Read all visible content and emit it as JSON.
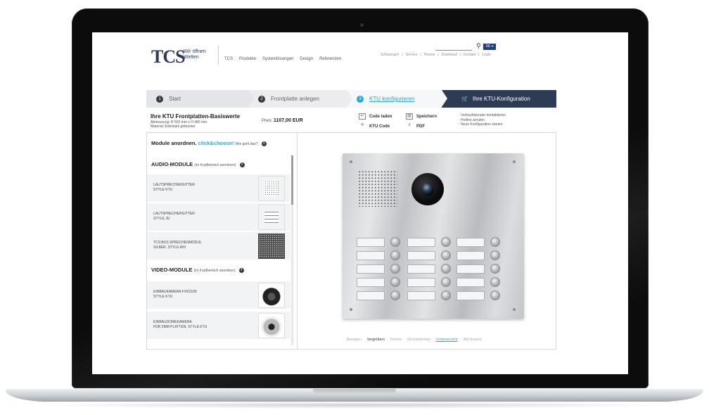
{
  "header": {
    "logo": "TCS",
    "tagline_lines": [
      "Wir öffnen",
      "Welten"
    ],
    "main_nav": [
      "TCS",
      "Produkte",
      "Systemlösungen",
      "Design",
      "Referenzen"
    ],
    "language": "DE ▾",
    "service_nav": [
      "Schulungen",
      "Service",
      "Presse",
      "Download",
      "Kontakt",
      "Login"
    ]
  },
  "steps": [
    {
      "num": "1",
      "label": "Start"
    },
    {
      "num": "2",
      "label": "Frontplatte anlegen"
    },
    {
      "num": "3",
      "label": "KTU konfigurieren"
    },
    {
      "num": "",
      "label": "Ihre KTU-Konfiguration"
    }
  ],
  "summary": {
    "title": "Ihre KTU Frontplatten-Basiswerte",
    "dimensions": "Abmessung: B 500 mm x H 480 mm",
    "material": "Material:  Edelstahl gebürstet",
    "price_label": "Preis:",
    "price_value": "1107,00 EUR",
    "tools": {
      "load": "Code laden",
      "save": "Speichern",
      "code": "KTU Code",
      "pdf": "PDF"
    },
    "links": [
      "· Verkaufsberater kontaktieren",
      "· Hotline anrufen",
      "· Neue Konfiguration starten"
    ]
  },
  "modules": {
    "arrange_title": "Module anordnen.",
    "arrange_highlight": "click&choose!",
    "arrange_hint": "Wie geht das?",
    "audio_title": "AUDIO-MODULE",
    "audio_hint": "(im Kopfbereich anordnen)",
    "audio_items": [
      {
        "line1": "LAUTSPRECHERGITTER",
        "line2": "STYLE KTU"
      },
      {
        "line1": "LAUTSPRECHERGITTER",
        "line2": "STYLE JU"
      },
      {
        "line1": "TCS:BUS SPRECHENMODUL",
        "line2": "SILBER, STYLE AHI"
      }
    ],
    "video_title": "VIDEO-MODULE",
    "video_hint": "(im Kopfbereich anordnen)",
    "video_items": [
      {
        "line1": "EINBAUKAMERA FVK2100",
        "line2": "STYLE KTU"
      },
      {
        "line1": "EINBAUDOMEKAMERA",
        "line2": "FÜR 2MM PLATTEN, STYLE KTU"
      }
    ]
  },
  "view_tabs": [
    "Bewegen",
    "Vergrößern",
    "Drehen",
    "Rückwärtsnavi",
    "Vorderansicht",
    "360 Ansicht"
  ],
  "colors": {
    "navy": "#2d3b55",
    "accent": "#2aa9d6",
    "brand_blue": "#1f3d7a"
  }
}
